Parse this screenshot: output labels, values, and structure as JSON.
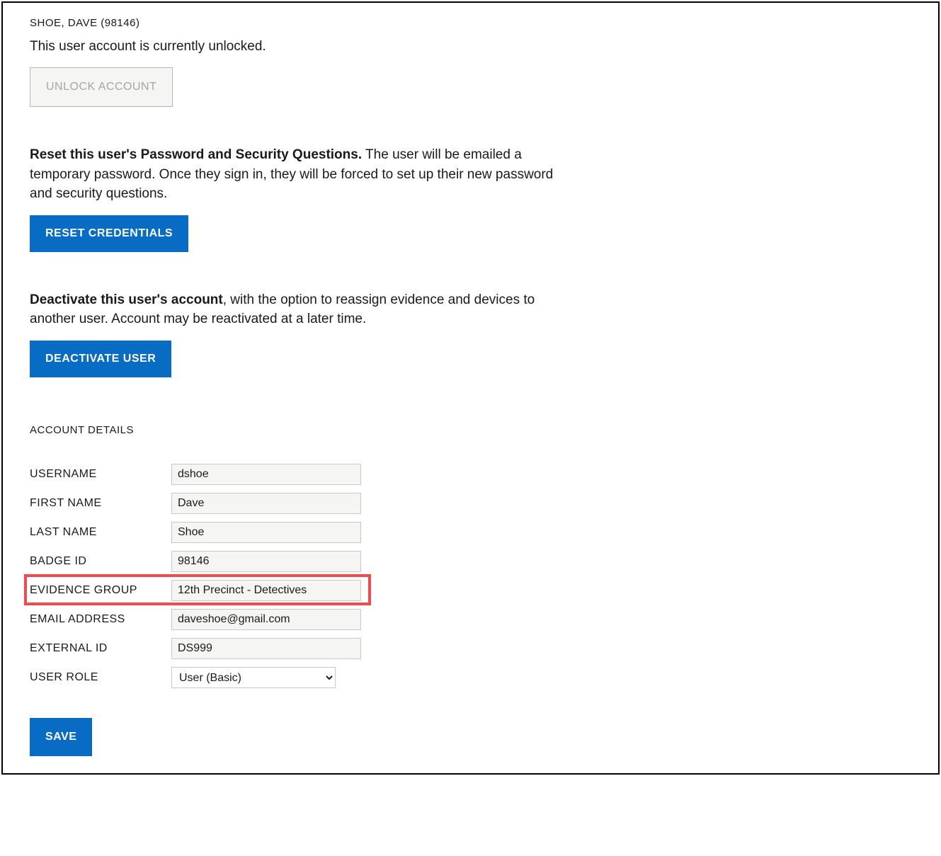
{
  "header": {
    "user_heading": "SHOE, DAVE (98146)",
    "unlock_status": "This user account is currently unlocked.",
    "unlock_button_label": "UNLOCK ACCOUNT"
  },
  "reset_section": {
    "bold_text": "Reset this user's Password and Security Questions.",
    "remainder_text": " The user will be emailed a temporary password. Once they sign in, they will be forced to set up their new password and security questions.",
    "button_label": "RESET CREDENTIALS"
  },
  "deactivate_section": {
    "bold_text": "Deactivate this user's account",
    "remainder_text": ", with the option to reassign evidence and devices to another user. Account may be reactivated at a later time.",
    "button_label": "DEACTIVATE USER"
  },
  "details": {
    "heading": "ACCOUNT DETAILS",
    "fields": {
      "username": {
        "label": "USERNAME",
        "value": "dshoe"
      },
      "first_name": {
        "label": "FIRST NAME",
        "value": "Dave"
      },
      "last_name": {
        "label": "LAST NAME",
        "value": "Shoe"
      },
      "badge_id": {
        "label": "BADGE ID",
        "value": "98146"
      },
      "evidence_group": {
        "label": "EVIDENCE GROUP",
        "value": "12th Precinct - Detectives"
      },
      "email": {
        "label": "EMAIL ADDRESS",
        "value": "daveshoe@gmail.com"
      },
      "external_id": {
        "label": "EXTERNAL ID",
        "value": "DS999"
      },
      "user_role": {
        "label": "USER ROLE",
        "value": "User (Basic)"
      }
    },
    "save_label": "SAVE"
  }
}
